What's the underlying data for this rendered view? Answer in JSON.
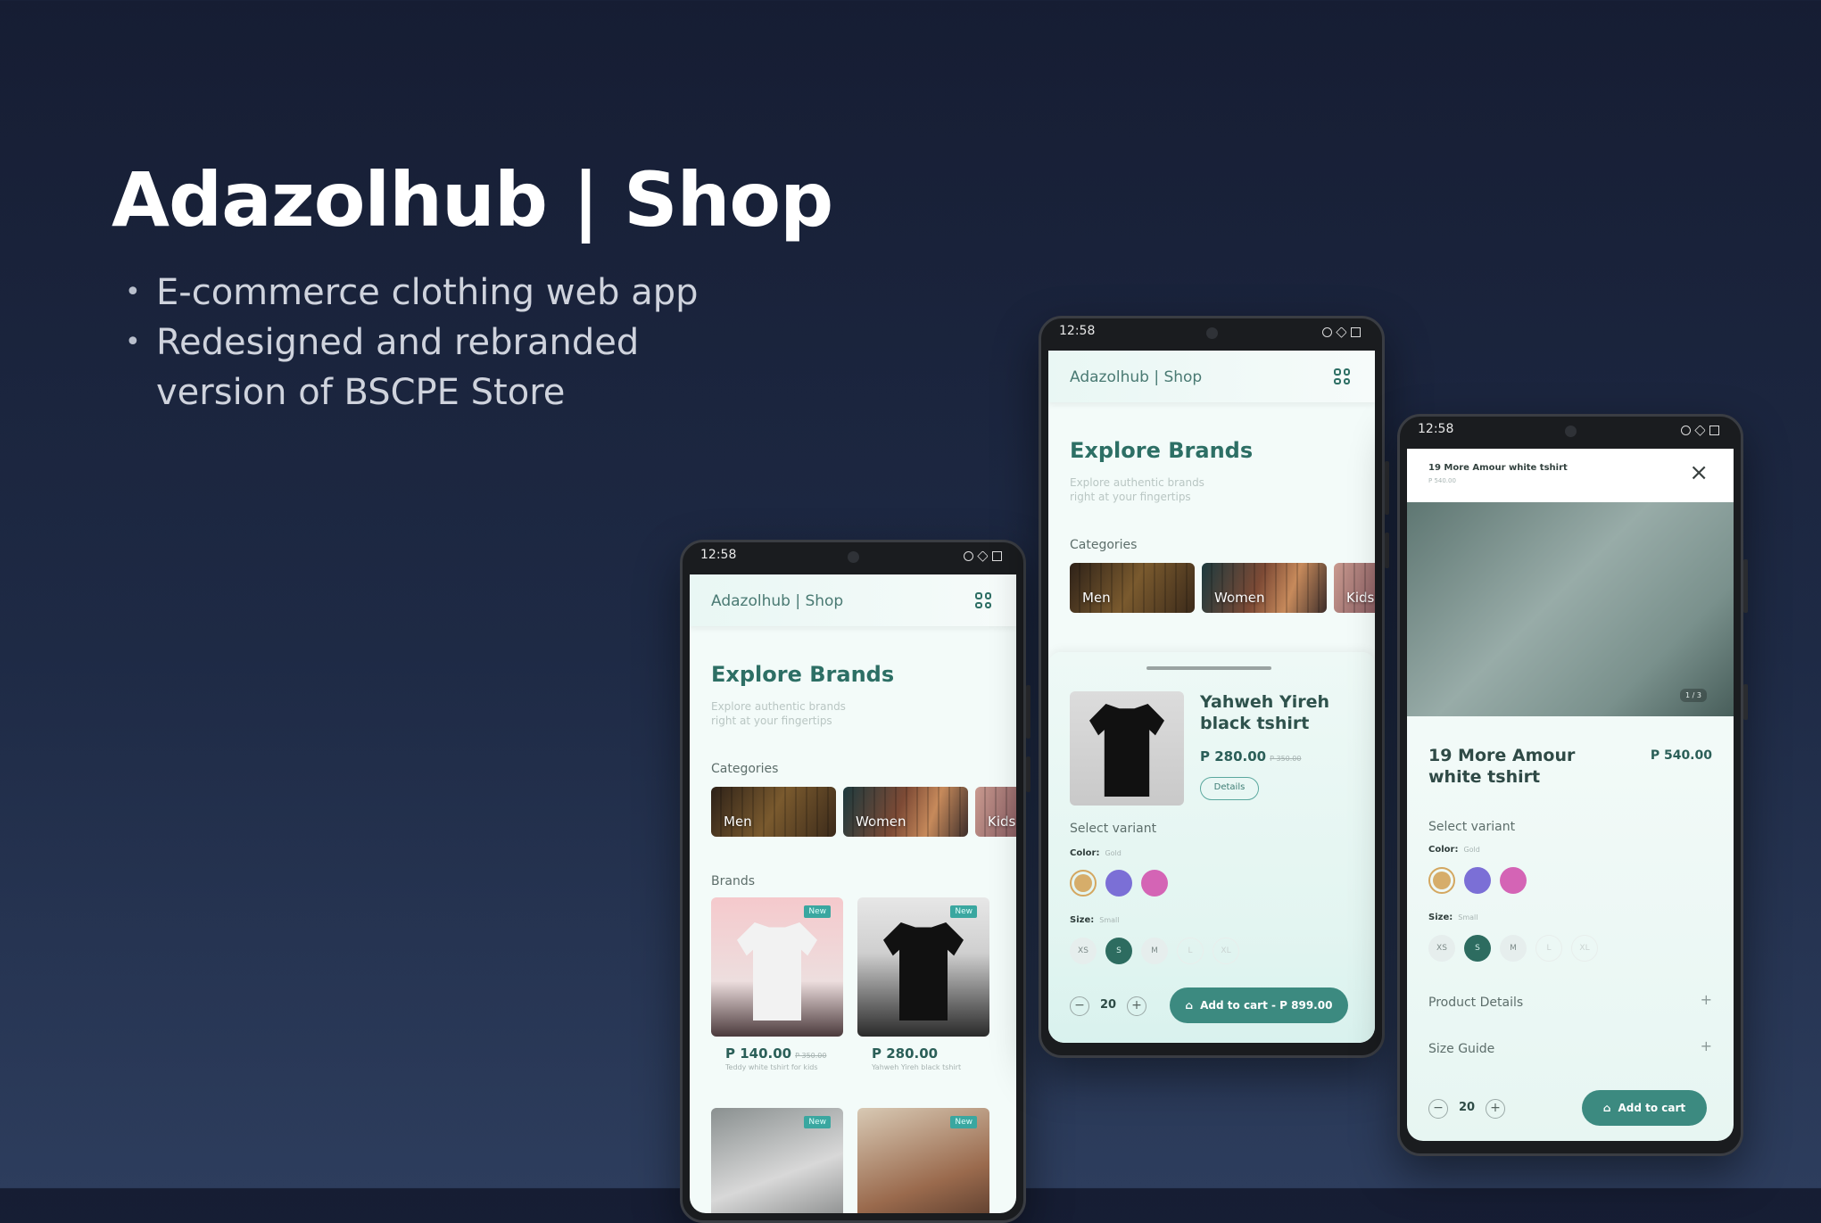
{
  "hero": {
    "title": "Adazolhub | Shop",
    "bullets": [
      "E-commerce clothing web app",
      "Redesigned and rebranded version of BSCPE Store"
    ]
  },
  "status_time": "12:58",
  "app": {
    "brand": "Adazolhub | Shop",
    "explore_title": "Explore Brands",
    "explore_subtitle": "Explore authentic brands right at your fingertips",
    "categories_label": "Categories",
    "categories": [
      "Men",
      "Women",
      "Kids"
    ],
    "brands_label": "Brands",
    "badge": "New"
  },
  "products": [
    {
      "price": "P 140.00",
      "old_price": "P 350.00",
      "name": "Teddy white tshirt for kids"
    },
    {
      "price": "P 280.00",
      "name": "Yahweh Yireh black tshirt"
    }
  ],
  "sheet": {
    "title": "Yahweh Yireh black tshirt",
    "price": "P 280.00",
    "old_price": "P 350.00",
    "details_label": "Details",
    "select_variant": "Select variant",
    "color_label": "Color:",
    "color_value": "Gold",
    "size_label": "Size:",
    "size_value": "Small",
    "sizes": [
      "XS",
      "S",
      "M",
      "L",
      "XL"
    ],
    "quantity": "20",
    "cart_label": "Add to cart - P 899.00"
  },
  "detail": {
    "header_title": "19 More Amour white tshirt",
    "header_price": "P 540.00",
    "image_counter": "1 / 3",
    "title": "19 More Amour white tshirt",
    "price": "P 540.00",
    "select_variant": "Select variant",
    "color_label": "Color:",
    "color_value": "Gold",
    "size_label": "Size:",
    "size_value": "Small",
    "sizes": [
      "XS",
      "S",
      "M",
      "L",
      "XL"
    ],
    "product_details": "Product Details",
    "size_guide": "Size Guide",
    "quantity": "20",
    "cart_label": "Add to cart"
  },
  "colors": {
    "swatches": [
      "#d6ad6a",
      "#7b6fd6",
      "#d464b5"
    ],
    "accent": "#3c8a80"
  }
}
